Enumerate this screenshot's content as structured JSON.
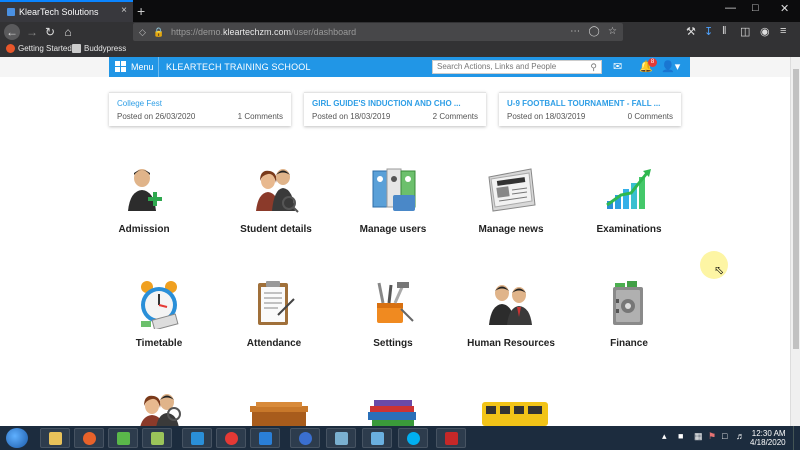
{
  "browser": {
    "tab_title": "KlearTech Solutions",
    "tab_close": "×",
    "new_tab": "+",
    "url_prefix": "https://demo.",
    "url_host": "kleartechzm.com",
    "url_path": "/user/dashboard",
    "bookmarks": [
      "Getting Started",
      "Buddypress"
    ]
  },
  "header": {
    "menu_label": "Menu",
    "school_name": "KLEARTECH TRAINING SCHOOL",
    "search_placeholder": "Search Actions, Links and People",
    "notification_count": "8",
    "accent_color": "#2196e6"
  },
  "news": [
    {
      "title": "College Fest",
      "posted": "Posted on 26/03/2020",
      "comments": "1 Comments"
    },
    {
      "title": "GIRL GUIDE'S INDUCTION AND CHO ...",
      "posted": "Posted on 18/03/2019",
      "comments": "2 Comments"
    },
    {
      "title": "U-9 FOOTBALL TOURNAMENT - FALL ...",
      "posted": "Posted on 18/03/2019",
      "comments": "0 Comments"
    }
  ],
  "modules": [
    {
      "label": "Admission",
      "icon": "admission-icon"
    },
    {
      "label": "Student details",
      "icon": "student-details-icon"
    },
    {
      "label": "Manage users",
      "icon": "manage-users-icon"
    },
    {
      "label": "Manage news",
      "icon": "manage-news-icon"
    },
    {
      "label": "Examinations",
      "icon": "examinations-icon"
    },
    {
      "label": "Timetable",
      "icon": "timetable-icon"
    },
    {
      "label": "Attendance",
      "icon": "attendance-icon"
    },
    {
      "label": "Settings",
      "icon": "settings-icon"
    },
    {
      "label": "Human Resources",
      "icon": "human-resources-icon"
    },
    {
      "label": "Finance",
      "icon": "finance-icon"
    }
  ],
  "taskbar": {
    "time": "12:30 AM",
    "date": "4/18/2020"
  }
}
